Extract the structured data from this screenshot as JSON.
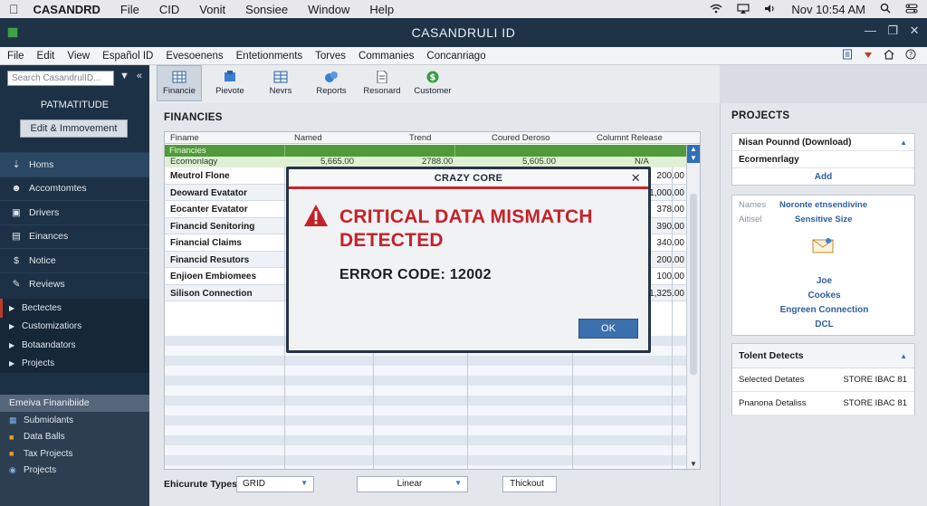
{
  "mac_menubar": {
    "app_name": "CASANDRD",
    "items": [
      "File",
      "CID",
      "Vonit",
      "Sonsiee",
      "Window",
      "Help"
    ],
    "clock": "Nov 10:54 AM"
  },
  "window": {
    "title": "CASANDRULI ID"
  },
  "app_menu": {
    "items": [
      "File",
      "Edit",
      "View",
      "Español ID",
      "Evesoenens",
      "Entetionments",
      "Torves",
      "Commanies",
      "Concanriago"
    ]
  },
  "sidebar": {
    "search_placeholder": "Search CasandrulID...",
    "section_title": "PATMATITUDE",
    "edit_button": "Edit & Immovement",
    "nav": [
      {
        "label": "Homs",
        "icon": "home-icon"
      },
      {
        "label": "Accomtomtes",
        "icon": "accounts-icon"
      },
      {
        "label": "Drivers",
        "icon": "drivers-icon"
      },
      {
        "label": "Einances",
        "icon": "finances-icon"
      },
      {
        "label": "Notice",
        "icon": "dollar-icon"
      },
      {
        "label": "Reviews",
        "icon": "reviews-icon"
      }
    ],
    "tree": [
      "Bectectes",
      "Customizatiors",
      "Botaandators",
      "Projects"
    ],
    "lower_header": "Emeiva Finanibiide",
    "lower_items": [
      "Submiolants",
      "Data Balls",
      "Tax Projects",
      "Projects"
    ]
  },
  "toolbar": {
    "buttons": [
      "Financie",
      "Pievote",
      "Nevrs",
      "Reports",
      "Resonard",
      "Customer"
    ]
  },
  "main": {
    "title": "FINANCIES",
    "columns": [
      "Finame",
      "Named",
      "Trend",
      "Coured Deroso",
      "Columnt Release"
    ],
    "group_label": "Financies",
    "sub_row": {
      "name": "Ecomonlagy",
      "c2": "5,665.00",
      "c3": "2788.00",
      "c4": "5,605.00",
      "c5": "N/A"
    },
    "rows": [
      {
        "name": "Meutrol Flone",
        "value": "200.00"
      },
      {
        "name": "Deoward Evatator",
        "value": "1,000.00"
      },
      {
        "name": "Eocanter Evatator",
        "value": "378.00"
      },
      {
        "name": "Financid Senitoring",
        "value": "390.00"
      },
      {
        "name": "Financial Claims",
        "value": "340.00"
      },
      {
        "name": "Financid Resutors",
        "value": "200.00"
      },
      {
        "name": "Enjioen Embiomees",
        "value": "100.00"
      },
      {
        "name": "Silison Connection",
        "value": "1,325.00"
      }
    ],
    "bottom": {
      "label": "Ehicurute Types:",
      "dropdown1": "GRID",
      "dropdown2": "Linear",
      "button": "Thickout"
    }
  },
  "right_panel": {
    "title": "PROJECTS",
    "box1": {
      "row1": "Nisan Pounnd (Download)",
      "row2": "Ecormenrlagy",
      "add": "Add"
    },
    "box2": {
      "k1": "Names",
      "v1": "Noronte etnsendivine",
      "k2": "Aitisel",
      "v2": "Sensitive Size",
      "links": [
        "Joe",
        "Cookes",
        "Engreen Connection",
        "DCL"
      ]
    },
    "box3": {
      "title": "Tolent Detects",
      "rows": [
        {
          "label": "Selected Detates",
          "value": "STORE IBAC 81"
        },
        {
          "label": "Pnanona Detaliss",
          "value": "STORE IBAC 81"
        }
      ]
    }
  },
  "modal": {
    "title": "CRAZY CORE",
    "message": "CRITICAL DATA MISMATCH DETECTED",
    "code": "ERROR CODE: 12002",
    "ok": "OK"
  },
  "colors": {
    "sidebar_bg": "#1d3146",
    "group_green": "#4f9a3a",
    "alert_red": "#c4222a",
    "ok_blue": "#3b6fae"
  }
}
